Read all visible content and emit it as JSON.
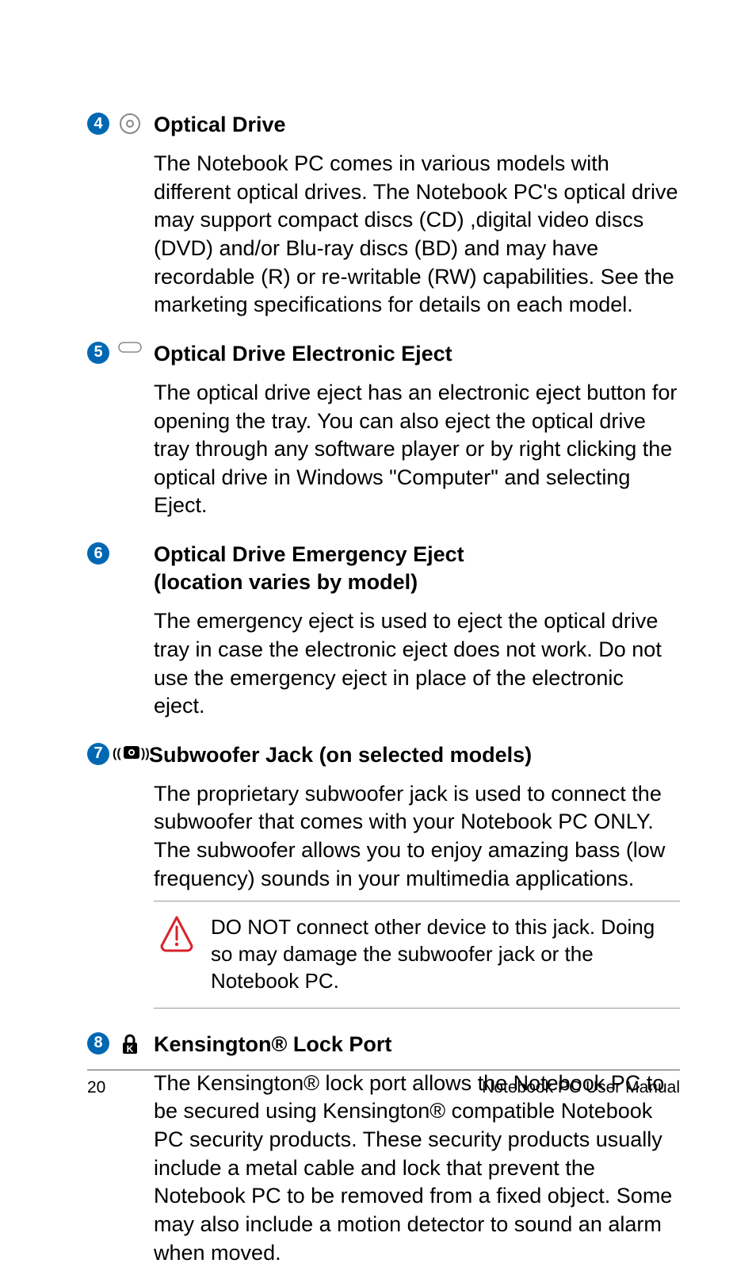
{
  "sections": {
    "s4": {
      "num": "4",
      "heading": "Optical Drive",
      "body": "The Notebook PC comes in various models with different optical drives. The Notebook PC's optical drive may support compact discs (CD) ,digital video discs (DVD) and/or Blu-ray discs (BD) and may have recordable (R) or re-writable (RW) capabilities. See the marketing specifications for details on each model."
    },
    "s5": {
      "num": "5",
      "heading": "Optical Drive Electronic Eject",
      "body": "The optical drive eject has an electronic eject button for opening the tray. You can also eject the optical drive tray through any software player or by right clicking the optical drive in Windows \"Computer\" and selecting Eject."
    },
    "s6": {
      "num": "6",
      "heading": "Optical Drive Emergency Eject\n(location varies by model)",
      "body": "The emergency eject is used to eject the optical drive tray in case the electronic eject does not work. Do not use the emergency eject in place of the electronic eject."
    },
    "s7": {
      "num": "7",
      "heading": "Subwoofer Jack (on selected models)",
      "body": "The proprietary subwoofer jack is used to connect the subwoofer that comes with your Notebook PC ONLY. The subwoofer allows you to enjoy amazing bass (low frequency) sounds in your multimedia applications.",
      "note": "DO NOT connect other device to this jack. Doing so may damage the subwoofer jack or the Notebook PC."
    },
    "s8": {
      "num": "8",
      "heading": "Kensington® Lock Port",
      "body": "The Kensington® lock port allows the Notebook PC to be secured using Kensington® compatible Notebook PC security products. These security products usually include a metal cable and lock that prevent the Notebook PC to be removed from a fixed object. Some may also include a motion detector to sound an alarm when moved."
    }
  },
  "footer": {
    "page": "20",
    "title": "Notebook PC User Manual"
  }
}
